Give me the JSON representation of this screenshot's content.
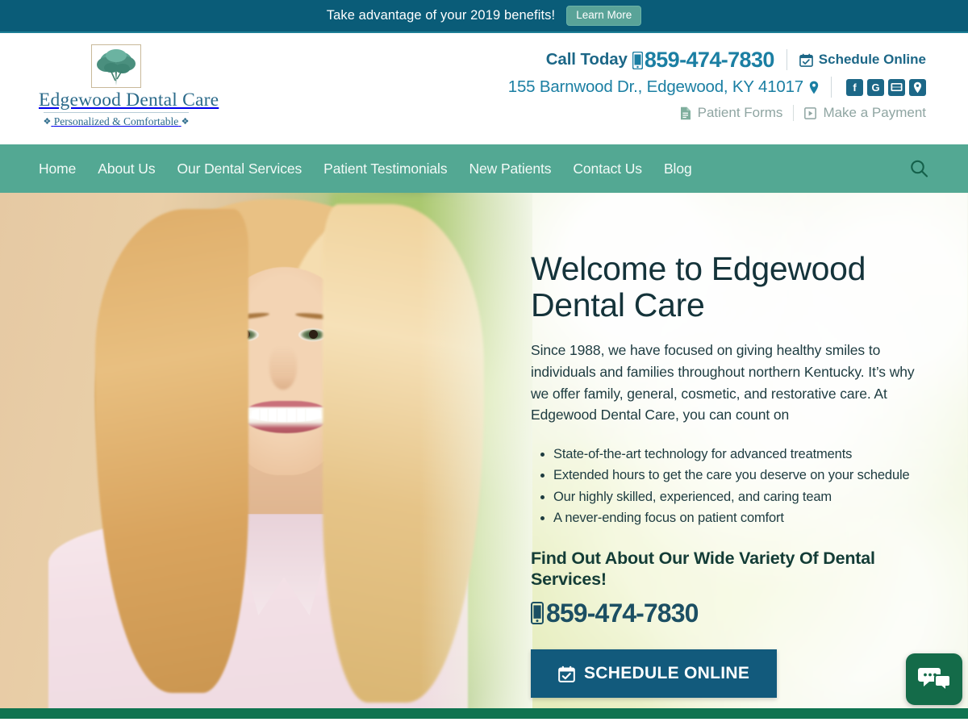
{
  "promo": {
    "text": "Take advantage of your 2019 benefits!",
    "button_label": "Learn More"
  },
  "logo": {
    "name": "Edgewood Dental Care",
    "tagline": "Personalized & Comfortable",
    "tree_icon": "tree-icon",
    "leaf_icon": "leaf-icon"
  },
  "header": {
    "call_today_label": "Call Today",
    "phone": "859-474-7830",
    "schedule_label": "Schedule Online",
    "address": "155 Barnwood Dr., Edgewood, KY 41017",
    "patient_forms_label": "Patient Forms",
    "make_payment_label": "Make a Payment",
    "socials": [
      {
        "name": "facebook",
        "glyph": "f"
      },
      {
        "name": "google",
        "glyph": "G"
      },
      {
        "name": "youtube",
        "glyph": "▶"
      },
      {
        "name": "map-location",
        "glyph": "●"
      }
    ]
  },
  "nav": {
    "items": [
      {
        "label": "Home"
      },
      {
        "label": "About Us"
      },
      {
        "label": "Our Dental Services"
      },
      {
        "label": "Patient Testimonials"
      },
      {
        "label": "New Patients"
      },
      {
        "label": "Contact Us"
      },
      {
        "label": "Blog"
      }
    ],
    "search_icon": "search-icon"
  },
  "hero": {
    "heading": "Welcome to Edgewood Dental Care",
    "paragraph": "Since 1988, we have focused on giving healthy smiles to individuals and families throughout northern Kentucky. It’s why we offer family, general, cosmetic, and restorative care. At Edgewood Dental Care, you can count on",
    "bullets": [
      "State-of-the-art technology for advanced treatments",
      "Extended hours to get the care you deserve on your schedule",
      "Our highly skilled, experienced, and caring team",
      "A never-ending focus on patient comfort"
    ],
    "subheading": "Find Out About Our Wide Variety Of Dental Services!",
    "phone": "859-474-7830",
    "cta_label": "SCHEDULE ONLINE"
  },
  "chat": {
    "icon": "chat-bubbles-icon"
  },
  "colors": {
    "promo_bg": "#0a5c78",
    "promo_button": "#59a398",
    "nav_bg": "#53a893",
    "header_teal": "#1c6787",
    "phone_blue": "#1b7fa3",
    "cta_bg": "#125a7c",
    "chat_bg": "#146b49",
    "bottom_strip": "#0f7350",
    "logo_blue": "#2b6a8a"
  }
}
